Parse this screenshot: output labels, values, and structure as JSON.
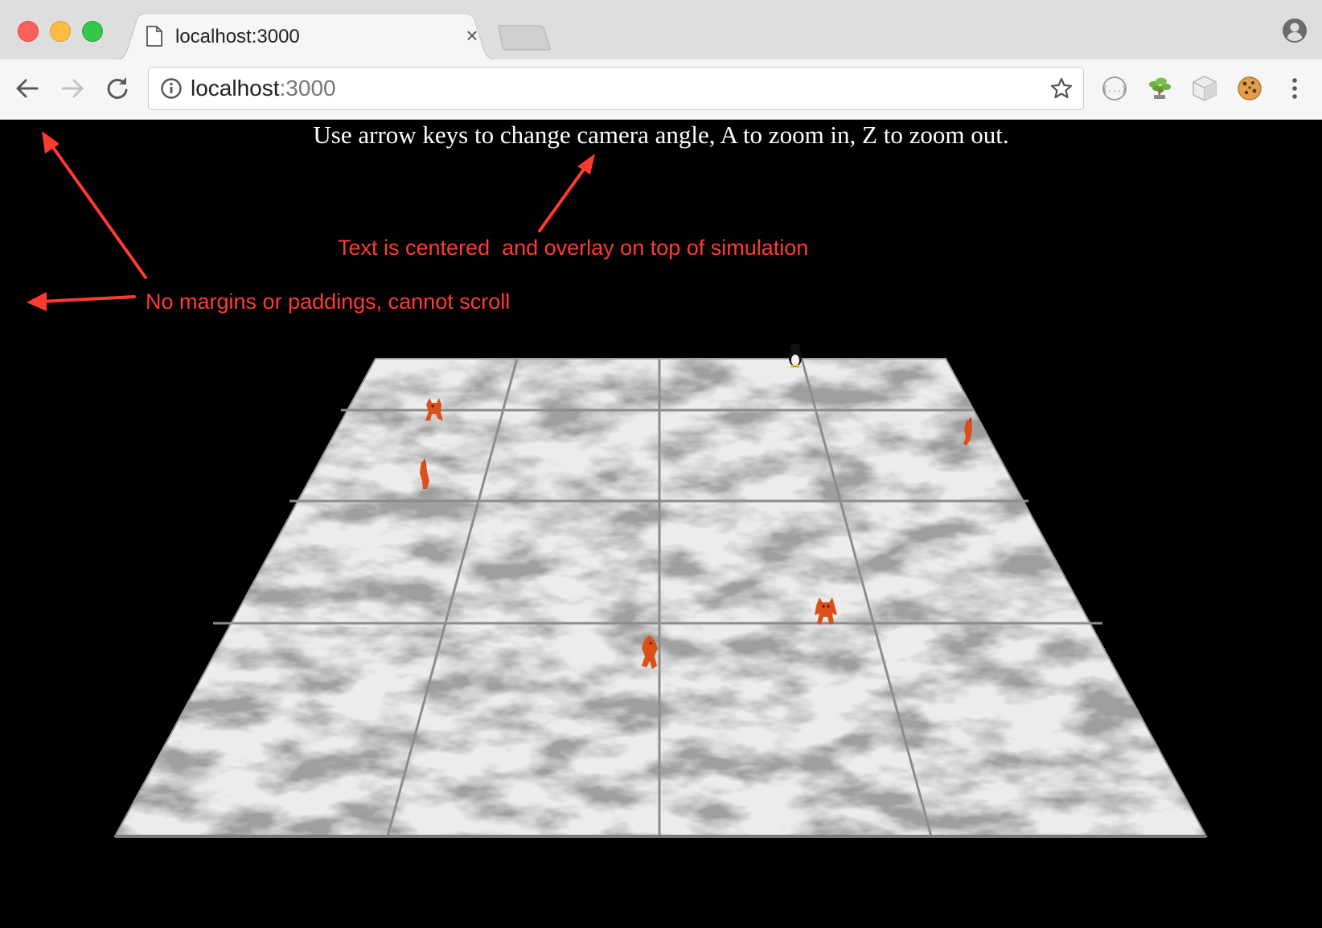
{
  "browser": {
    "tab": {
      "title": "localhost:3000",
      "close_glyph": "×"
    },
    "address_bar": {
      "host": "localhost",
      "port": ":3000"
    },
    "icons": {
      "back": "back-arrow-icon",
      "forward": "forward-arrow-icon",
      "reload": "reload-icon",
      "site_info": "info-icon",
      "bookmark": "star-icon",
      "profile": "profile-icon",
      "menu": "kebab-menu-icon"
    },
    "extensions": [
      "json-formatter-icon",
      "bonsai-tree-icon",
      "cube-icon",
      "cookie-icon"
    ]
  },
  "page": {
    "instructions": "Use arrow keys to change camera angle, A to zoom in, Z to zoom out.",
    "background_color": "#000000",
    "text_color": "#ffffff"
  },
  "annotations": {
    "color": "#ff3b30",
    "centered_note": "Text is centered  and overlay on top of simulation",
    "margin_note": "No margins or paddings, cannot scroll"
  },
  "simulation": {
    "floor_grid": {
      "rows": 4,
      "cols": 4
    },
    "tile_texture": "marble",
    "entities": [
      {
        "type": "tux-penguin",
        "color": "#111111"
      },
      {
        "type": "fox",
        "color": "#d9501a"
      },
      {
        "type": "fox",
        "color": "#d9501a"
      },
      {
        "type": "fox",
        "color": "#d9501a"
      },
      {
        "type": "fox",
        "color": "#d9501a"
      },
      {
        "type": "fox",
        "color": "#d9501a"
      }
    ]
  }
}
